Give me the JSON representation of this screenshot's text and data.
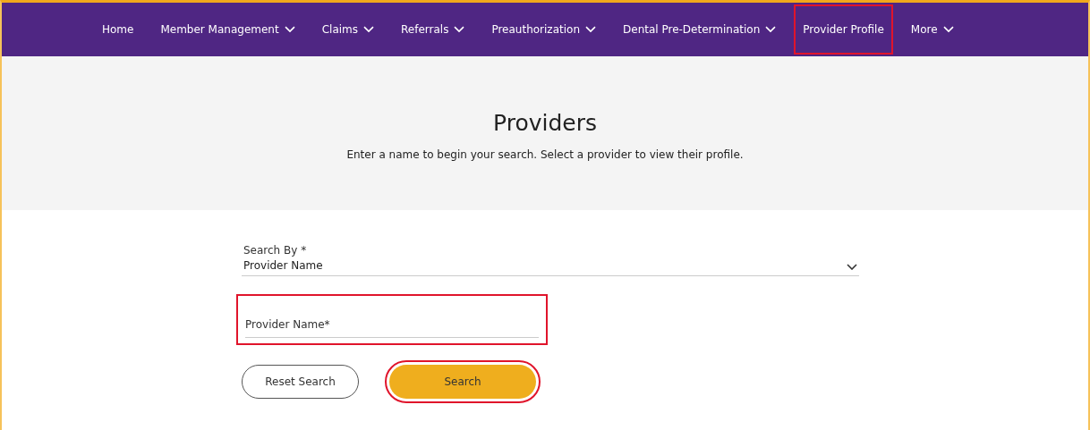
{
  "nav": {
    "items": [
      {
        "label": "Home",
        "kind": "link",
        "highlighted": false
      },
      {
        "label": "Member Management",
        "kind": "menu",
        "highlighted": false
      },
      {
        "label": "Claims",
        "kind": "menu",
        "highlighted": false
      },
      {
        "label": "Referrals",
        "kind": "menu",
        "highlighted": false
      },
      {
        "label": "Preauthorization",
        "kind": "menu",
        "highlighted": false
      },
      {
        "label": "Dental Pre-Determination",
        "kind": "menu",
        "highlighted": false
      },
      {
        "label": "Provider Profile",
        "kind": "link",
        "highlighted": true
      },
      {
        "label": "More",
        "kind": "menu",
        "highlighted": false
      }
    ]
  },
  "hero": {
    "title": "Providers",
    "subtitle": "Enter a name to begin your search. Select a provider to view their profile."
  },
  "form": {
    "search_by": {
      "label": "Search By",
      "required_mark": "*",
      "value": "Provider Name"
    },
    "provider_name": {
      "placeholder": "Provider Name*",
      "highlighted": true
    },
    "buttons": [
      {
        "label": "Reset Search",
        "kind": "secondary",
        "highlighted": false
      },
      {
        "label": "Search",
        "kind": "primary",
        "highlighted": true
      }
    ]
  }
}
